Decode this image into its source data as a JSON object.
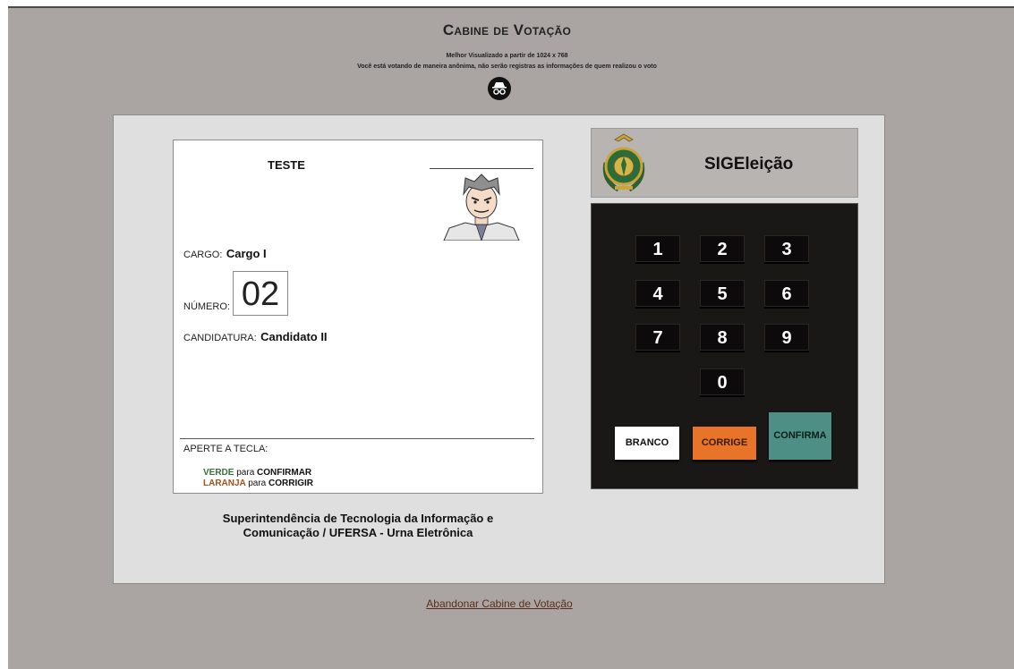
{
  "header": {
    "title": "Cabine de Votação",
    "resolution_note": "Melhor Visualizado a partir de 1024 x 768",
    "anonymity_note": "Você está votando de maneira anônima, não serão registras as informações de quem realizou o voto"
  },
  "ballot": {
    "election_title": "TESTE",
    "cargo_label": "CARGO:",
    "cargo_value": "Cargo I",
    "numero_label": "NÚMERO:",
    "numero_value": "02",
    "candidatura_label": "CANDIDATURA:",
    "candidatura_value": "Candidato II",
    "aperte_label": "APERTE A TECLA:",
    "instr_verde_color": "VERDE",
    "instr_verde_rest": "para",
    "instr_verde_action": "CONFIRMAR",
    "instr_laranja_color": "LARANJA",
    "instr_laranja_rest": "para",
    "instr_laranja_action": "CORRIGIR"
  },
  "footer": {
    "org_line1": "Superintendência de Tecnologia da Informação e",
    "org_line2": "Comunicação / UFERSA - Urna Eletrônica",
    "abandon_link": "Abandonar Cabine de Votação"
  },
  "urn": {
    "brand": "SIGEleição",
    "keys": [
      "1",
      "2",
      "3",
      "4",
      "5",
      "6",
      "7",
      "8",
      "9",
      "0"
    ],
    "branco_label": "BRANCO",
    "corrige_label": "CORRIGE",
    "confirma_label": "CONFIRMA"
  },
  "colors": {
    "background": "#aaa5a3",
    "panel": "#e0dfdf",
    "keypad": "#1a1717",
    "corrige": "#e8742a",
    "confirma": "#4d8f84",
    "verde_text": "#3d6e3d",
    "laranja_text": "#a0521b"
  }
}
